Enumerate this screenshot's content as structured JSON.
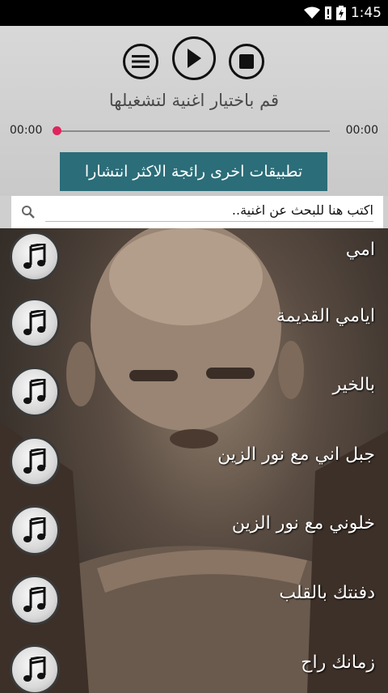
{
  "status_bar": {
    "time": "1:45"
  },
  "player": {
    "now_playing": "قم باختيار اغنية لتشغيلها",
    "elapsed": "00:00",
    "duration": "00:00",
    "progress": 0,
    "apps_button_label": "تطبيقات اخرى رائجة الاكثر انتشارا"
  },
  "search": {
    "placeholder": "اكتب هنا للبحث عن اغنية.."
  },
  "songs": [
    {
      "title": "امي"
    },
    {
      "title": "ايامي القديمة"
    },
    {
      "title": "بالخير"
    },
    {
      "title": "جبل اني مع نور الزين"
    },
    {
      "title": "خلوني مع نور الزين"
    },
    {
      "title": "دفنتك بالقلب"
    },
    {
      "title": "زمانك راح"
    }
  ],
  "colors": {
    "accent_button": "#2b6d78",
    "seek_thumb": "#e0245e"
  }
}
